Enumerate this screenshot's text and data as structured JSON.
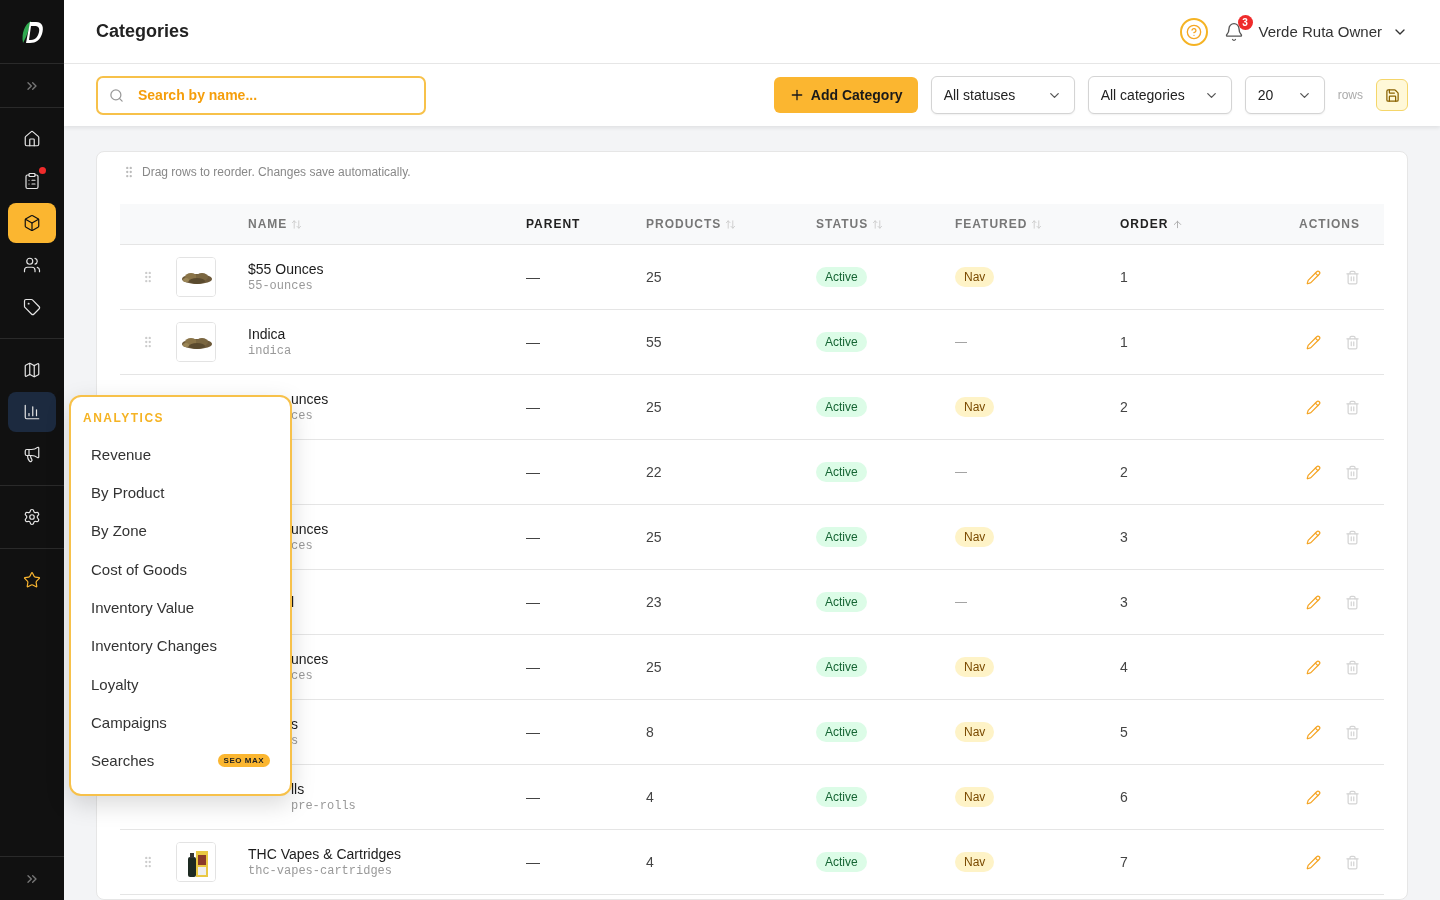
{
  "header": {
    "title": "Categories",
    "notifications": "3",
    "user": "Verde Ruta Owner"
  },
  "sidebar": {
    "items": [
      {
        "selected": false,
        "expanded": false,
        "dot": false
      },
      {
        "selected": false,
        "expanded": false,
        "dot": true
      },
      {
        "selected": true,
        "expanded": false,
        "dot": false
      },
      {
        "selected": false,
        "expanded": false,
        "dot": false
      },
      {
        "selected": false,
        "expanded": false,
        "dot": false
      },
      {
        "selected": false,
        "expanded": false,
        "dot": false
      },
      {
        "selected": false,
        "expanded": true,
        "dot": false
      },
      {
        "selected": false,
        "expanded": false,
        "dot": false
      },
      {
        "selected": false,
        "expanded": false,
        "dot": false
      },
      {
        "selected": false,
        "expanded": false,
        "dot": false
      }
    ]
  },
  "toolbar": {
    "search": {
      "placeholder": "Search by name..."
    },
    "add_button": "Add Category",
    "filters": [
      {
        "value": "All statuses"
      },
      {
        "value": "All categories"
      },
      {
        "value": "20"
      }
    ],
    "rows_label": "rows"
  },
  "hint": "Drag rows to reorder. Changes save automatically.",
  "table": {
    "columns": [
      {
        "label": "NAME",
        "kind": "sortable",
        "highlighted": false
      },
      {
        "label": "PARENT",
        "kind": "plain",
        "highlighted": true
      },
      {
        "label": "PRODUCTS",
        "kind": "sortable",
        "highlighted": false
      },
      {
        "label": "STATUS",
        "kind": "sortable",
        "highlighted": false
      },
      {
        "label": "FEATURED",
        "kind": "sortable",
        "highlighted": false
      },
      {
        "label": "ORDER",
        "kind": "ascending",
        "highlighted": true
      },
      {
        "label": "ACTIONS",
        "kind": "plain",
        "highlighted": false
      }
    ],
    "rows": [
      {
        "kind": "bud",
        "name": "$55 Ounces",
        "slug": "55-ounces",
        "parent": "—",
        "products": "25",
        "status": "Active",
        "featured": {
          "label": "Nav",
          "on": true
        },
        "order": "1"
      },
      {
        "kind": "bud",
        "name": "Indica",
        "slug": "indica",
        "parent": "—",
        "products": "55",
        "status": "Active",
        "featured": {
          "label": "—",
          "on": false
        },
        "order": "1"
      },
      {
        "kind": "covered",
        "name": "unces",
        "slug": "ces",
        "parent": "—",
        "products": "25",
        "status": "Active",
        "featured": {
          "label": "Nav",
          "on": true
        },
        "order": "2"
      },
      {
        "kind": "covered",
        "parent": "—",
        "products": "22",
        "status": "Active",
        "featured": {
          "label": "—",
          "on": false
        },
        "order": "2"
      },
      {
        "kind": "covered",
        "name": "unces",
        "slug": "ces",
        "parent": "—",
        "products": "25",
        "status": "Active",
        "featured": {
          "label": "Nav",
          "on": true
        },
        "order": "3"
      },
      {
        "kind": "covered",
        "name": "l",
        "parent": "—",
        "products": "23",
        "status": "Active",
        "featured": {
          "label": "—",
          "on": false
        },
        "order": "3"
      },
      {
        "kind": "covered",
        "name": "unces",
        "slug": "ces",
        "parent": "—",
        "products": "25",
        "status": "Active",
        "featured": {
          "label": "Nav",
          "on": true
        },
        "order": "4"
      },
      {
        "kind": "covered",
        "name": "s",
        "slug": "s",
        "parent": "—",
        "products": "8",
        "status": "Active",
        "featured": {
          "label": "Nav",
          "on": true
        },
        "order": "5"
      },
      {
        "kind": "covered",
        "name": "lls",
        "slug": "pre-rolls",
        "parent": "—",
        "products": "4",
        "status": "Active",
        "featured": {
          "label": "Nav",
          "on": true
        },
        "order": "6"
      },
      {
        "kind": "vape",
        "name": "THC Vapes & Cartridges",
        "slug": "thc-vapes-cartridges",
        "parent": "—",
        "products": "4",
        "status": "Active",
        "featured": {
          "label": "Nav",
          "on": true
        },
        "order": "7"
      }
    ]
  },
  "flyout": {
    "title": "ANALYTICS",
    "items": [
      {
        "label": "Revenue"
      },
      {
        "label": "By Product"
      },
      {
        "label": "By Zone"
      },
      {
        "label": "Cost of Goods"
      },
      {
        "label": "Inventory Value"
      },
      {
        "label": "Inventory Changes"
      },
      {
        "label": "Loyalty"
      },
      {
        "label": "Campaigns"
      },
      {
        "label": "Searches",
        "badge": "SEO MAX"
      }
    ]
  }
}
